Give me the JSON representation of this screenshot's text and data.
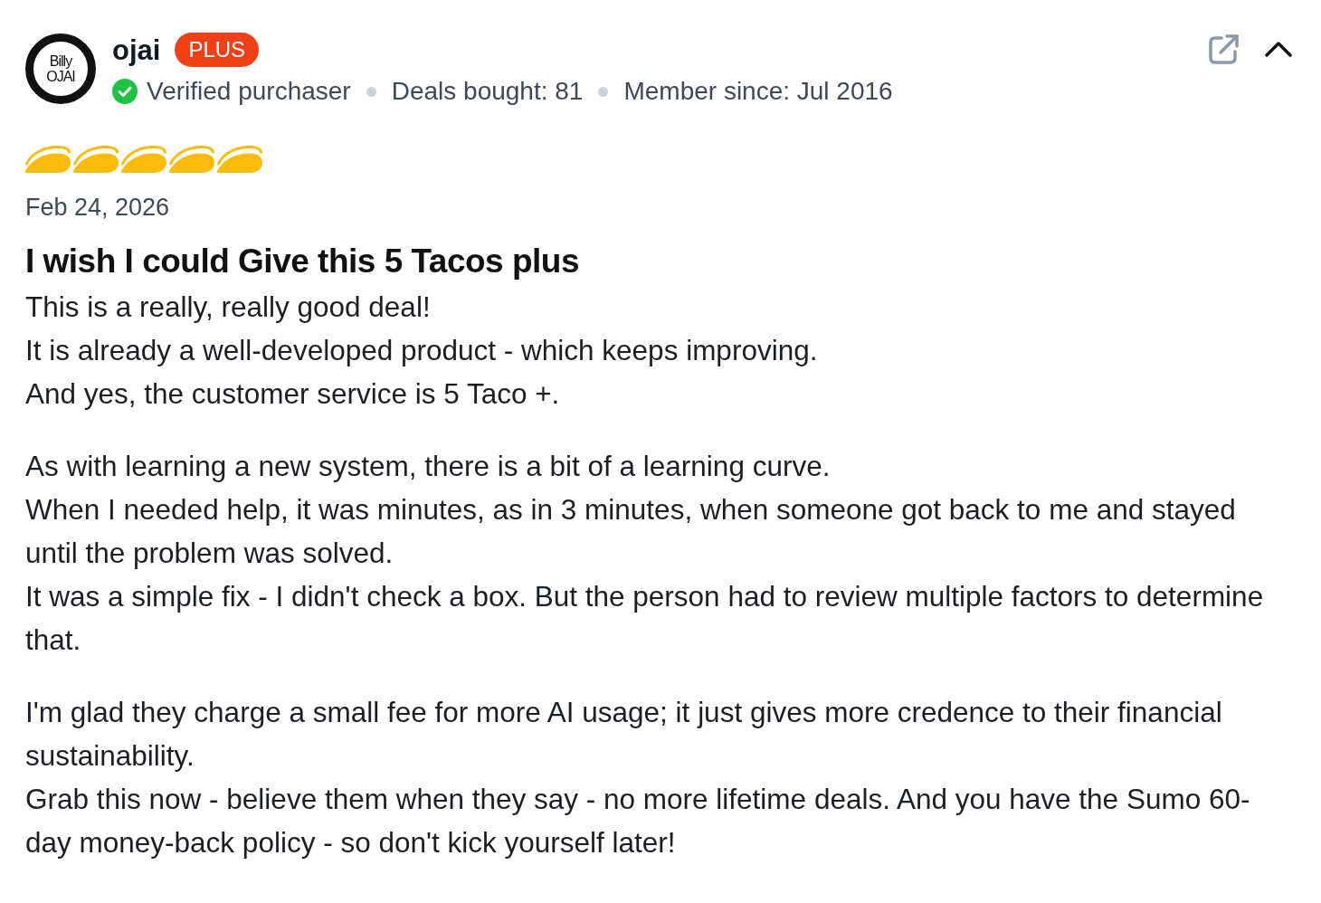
{
  "review": {
    "expanded": true,
    "reviewer": {
      "avatar": {
        "lines": [
          "Billy",
          "OJAI"
        ]
      },
      "name": "ojai",
      "badge": "PLUS",
      "meta": [
        {
          "kind": "verified",
          "text": "Verified purchaser"
        },
        {
          "kind": "plain",
          "text": "Deals bought: 81"
        },
        {
          "kind": "plain",
          "text": "Member since: Jul 2016"
        }
      ]
    },
    "rating": {
      "stars": 5
    },
    "date": "Feb 24, 2026",
    "title": "I wish I could Give this 5 Tacos plus",
    "paragraphs": [
      [
        "This is a really, really good deal!",
        "It is already a well-developed product - which keeps improving.",
        "And yes, the customer service is 5 Taco +."
      ],
      [
        "As with learning a new system, there is a bit of a learning curve.",
        "When I needed help, it was minutes, as in 3 minutes, when someone got back to me and stayed until the problem was solved.",
        "It was a simple fix - I didn't check a box. But the person had to review multiple factors to determine that."
      ],
      [
        "I'm glad they charge a small fee for more AI usage; it just gives more credence to their financial sustainability.",
        "Grab this now - believe them when they say - no more lifetime deals. And you have the Sumo 60-day money-back policy - so don't kick yourself later!"
      ]
    ]
  }
}
